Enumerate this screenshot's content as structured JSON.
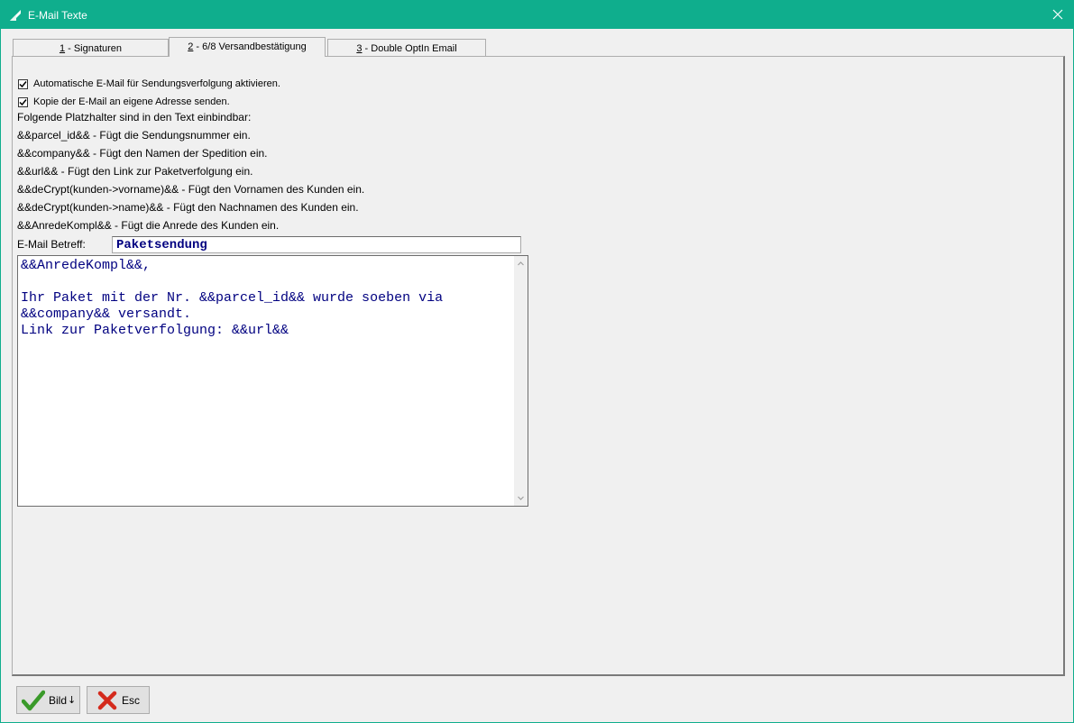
{
  "window": {
    "title": "E-Mail Texte"
  },
  "tabs": [
    {
      "label": "1 - Signaturen",
      "accel": "1",
      "rest": " - Signaturen"
    },
    {
      "label": "2 - 6/8 Versandbestätigung",
      "accel": "2",
      "rest": " - 6/8 Versandbestätigung"
    },
    {
      "label": "3 - Double OptIn Email",
      "accel": "3",
      "rest": " - Double OptIn Email"
    }
  ],
  "active_tab": 1,
  "options": {
    "auto_email": {
      "label": "Automatische E-Mail für Sendungsverfolgung aktivieren.",
      "checked": true
    },
    "copy_self": {
      "label": "Kopie der E-Mail an eigene Adresse senden.",
      "checked": true
    }
  },
  "placeholders": {
    "heading": "Folgende Platzhalter sind in den Text einbindbar:",
    "items": [
      "&&parcel_id&& - Fügt die Sendungsnummer ein.",
      "&&company&& - Fügt den Namen der Spedition ein.",
      "&&url&& - Fügt den Link zur Paketverfolgung ein.",
      "&&deCrypt(kunden->vorname)&& - Fügt den Vornamen des Kunden ein.",
      "&&deCrypt(kunden->name)&& - Fügt den Nachnamen des Kunden ein.",
      "&&AnredeKompl&& - Fügt die Anrede des Kunden ein."
    ]
  },
  "subject": {
    "label": "E-Mail Betreff:",
    "value": "Paketsendung"
  },
  "body_text": "&&AnredeKompl&&,\n\nIhr Paket mit der Nr. &&parcel_id&& wurde soeben via &&company&& versandt.\nLink zur Paketverfolgung: &&url&&",
  "buttons": {
    "bild": {
      "label": "Bild",
      "arrow": "↓"
    },
    "esc": {
      "label": "Esc"
    }
  },
  "colors": {
    "titlebar": "#0fae8d",
    "editor_text": "#000080",
    "check_green": "#3a9a2a",
    "esc_red": "#d42a1c"
  }
}
